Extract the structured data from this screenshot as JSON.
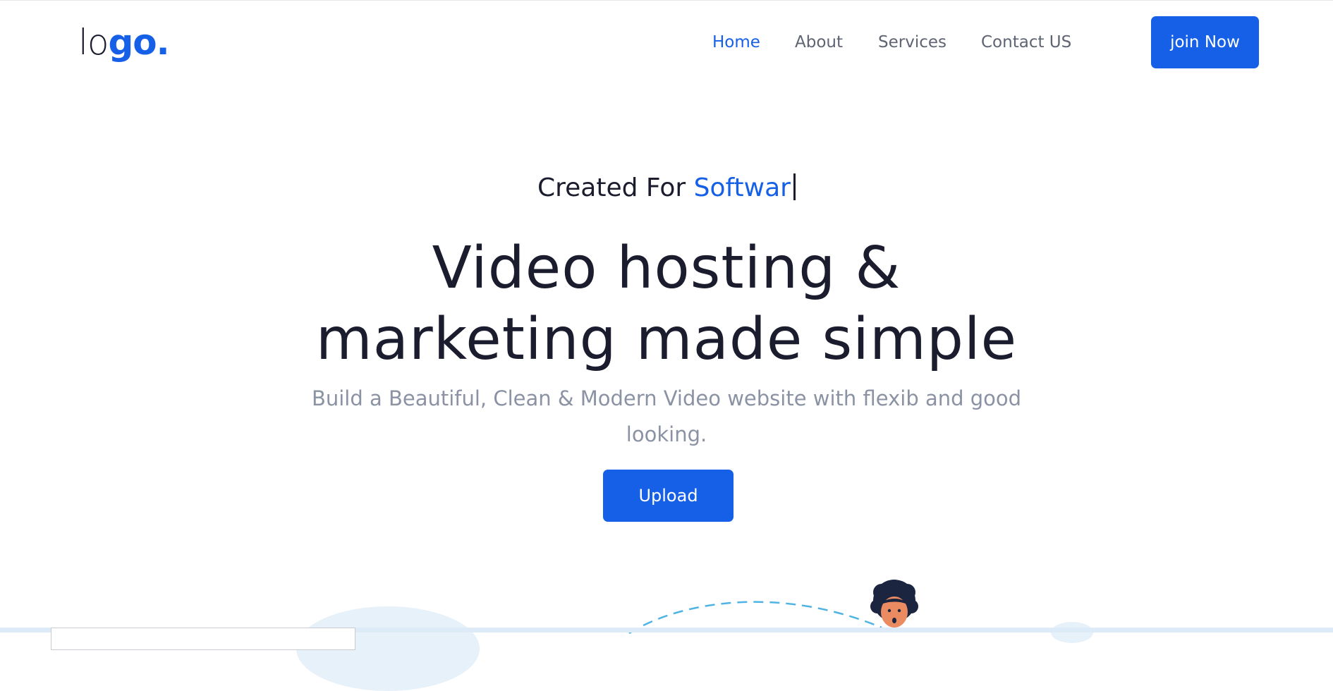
{
  "header": {
    "logo": {
      "part1": "lo",
      "part2": "go."
    },
    "nav": [
      {
        "label": "Home",
        "active": true
      },
      {
        "label": "About",
        "active": false
      },
      {
        "label": "Services",
        "active": false
      },
      {
        "label": "Contact US",
        "active": false
      }
    ],
    "cta_label": "join Now"
  },
  "hero": {
    "tag_prefix": "Created For",
    "tag_accent": "Softwar",
    "title_line1": "Video hosting &",
    "title_line2": "marketing made simple",
    "subtitle": "Build a Beautiful, Clean & Modern Video website with flexib and good looking.",
    "upload_label": "Upload"
  },
  "colors": {
    "accent": "#1660e8",
    "heading": "#1b1d2e",
    "muted": "#8a92a3",
    "nav_text": "#5f6473"
  }
}
